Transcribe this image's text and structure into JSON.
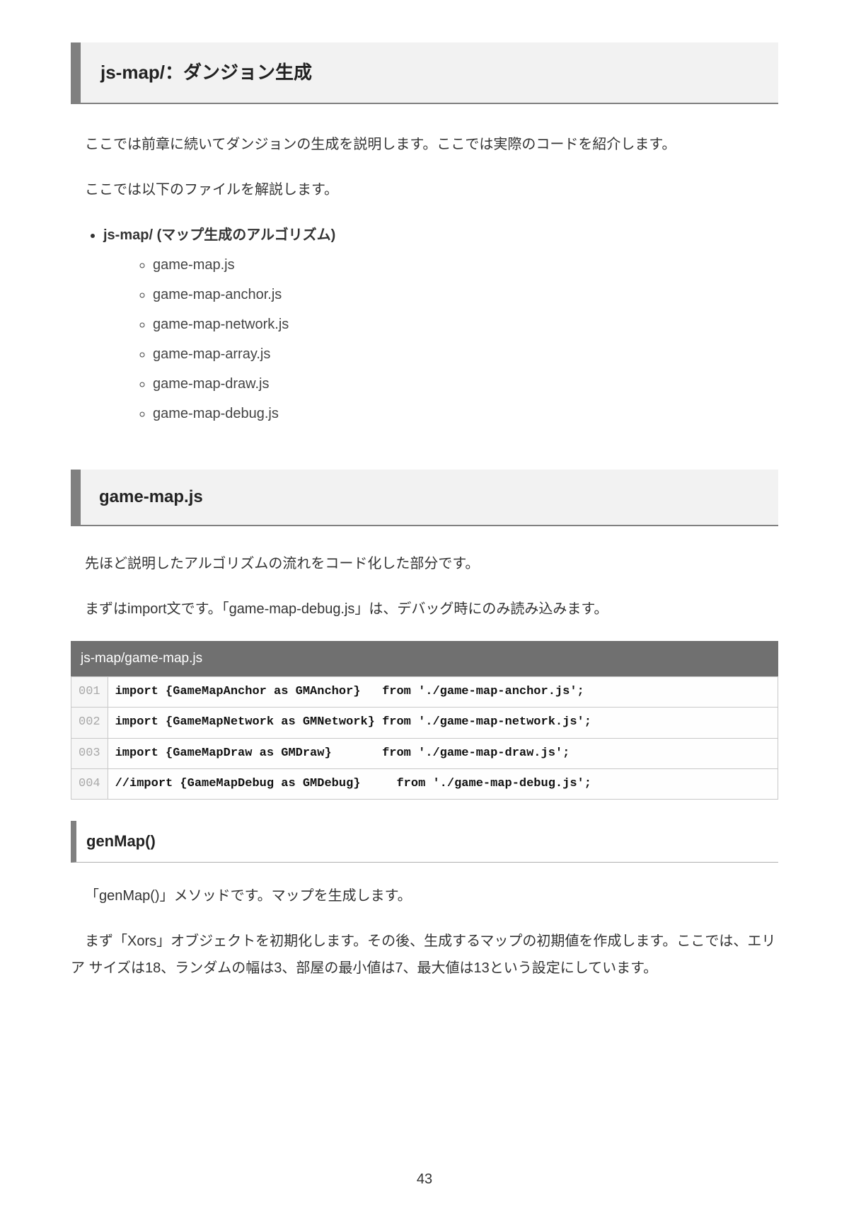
{
  "section1": {
    "title": "js-map/：ダンジョン生成",
    "p1": "ここでは前章に続いてダンジョンの生成を説明します。ここでは実際のコードを紹介します。",
    "p2": "ここでは以下のファイルを解説します。",
    "filesHeader": "js-map/ (マップ生成のアルゴリズム)",
    "files": [
      "game-map.js",
      "game-map-anchor.js",
      "game-map-network.js",
      "game-map-array.js",
      "game-map-draw.js",
      "game-map-debug.js"
    ]
  },
  "section2": {
    "title": "game-map.js",
    "p1": "先ほど説明したアルゴリズムの流れをコード化した部分です。",
    "p2": "まずはimport文です。「game-map-debug.js」は、デバッグ時にのみ読み込みます。",
    "codeFile": "js-map/game-map.js",
    "codeLines": [
      {
        "n": "001",
        "c": "import {GameMapAnchor as GMAnchor}   from './game-map-anchor.js';"
      },
      {
        "n": "002",
        "c": "import {GameMapNetwork as GMNetwork} from './game-map-network.js';"
      },
      {
        "n": "003",
        "c": "import {GameMapDraw as GMDraw}       from './game-map-draw.js';"
      },
      {
        "n": "004",
        "c": "//import {GameMapDebug as GMDebug}     from './game-map-debug.js';"
      }
    ]
  },
  "section3": {
    "title": "genMap()",
    "p1": "「genMap()」メソッドです。マップを生成します。",
    "p2": "まず「Xors」オブジェクトを初期化します。その後、生成するマップの初期値を作成します。ここでは、エリア サイズは18、ランダムの幅は3、部屋の最小値は7、最大値は13という設定にしています。"
  },
  "pageNumber": "43"
}
